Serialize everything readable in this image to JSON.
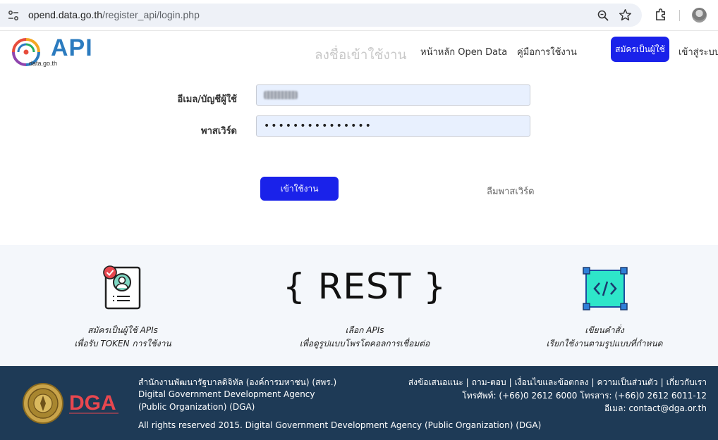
{
  "browser": {
    "url_host": "opend.data.go.th",
    "url_path": "/register_api/login.php"
  },
  "header": {
    "logo_text": "API",
    "logo_subtext": "data.go.th",
    "page_heading": "ลงชื่อเข้าใช้งาน",
    "nav_home": "หน้าหลัก Open Data",
    "nav_manual": "คู่มือการใช้งาน",
    "signup_label": "สมัครเป็นผู้ใช้",
    "login_label": "เข้าสู่ระบบ"
  },
  "form": {
    "email_label": "อีเมล/บัญชีผู้ใช้",
    "password_label": "พาสเวิร์ด",
    "password_value": "•••••••••••••••",
    "submit_label": "เข้าใช้งาน",
    "forgot_label": "ลืมพาสเวิร์ด"
  },
  "features": [
    {
      "icon": "register-user-icon",
      "title": "สมัครเป็นผู้ใช้ APIs",
      "desc": "เพื่อรับ TOKEN การใช้งาน"
    },
    {
      "icon": "rest-icon",
      "graphic_text": "{ REST }",
      "title": "เลือก APIs",
      "desc": "เพื่อดูรูปแบบโพรโตคอลการเชื่อมต่อ"
    },
    {
      "icon": "code-icon",
      "title": "เขียนคำสั่ง",
      "desc": "เรียกใช้งานตามรูปแบบที่กำหนด"
    }
  ],
  "footer": {
    "org_th": "สำนักงานพัฒนารัฐบาลดิจิทัล (องค์การมหาชน) (สพร.)",
    "org_en_1": "Digital Government Development Agency",
    "org_en_2": "(Public Organization) (DGA)",
    "copyright": "All rights reserved 2015. Digital Government Development Agency (Public Organization) (DGA)",
    "links": [
      "ส่งข้อเสนอแนะ",
      "ถาม-ตอบ",
      "เงื่อนไขและข้อตกลง",
      "ความเป็นส่วนตัว",
      "เกี่ยวกับเรา"
    ],
    "phone": "โทรศัพท์: (+66)0 2612 6000 โทรสาร: (+66)0 2612 6011-12",
    "email": "อีเมล: contact@dga.or.th",
    "dga_logo_text": "DGA"
  },
  "colors": {
    "primary_button": "#1a22ea",
    "logo_blue": "#2b7bbf",
    "footer_bg": "#1e3a56",
    "features_bg": "#f4f7fb",
    "input_bg": "#e8f0fe"
  }
}
